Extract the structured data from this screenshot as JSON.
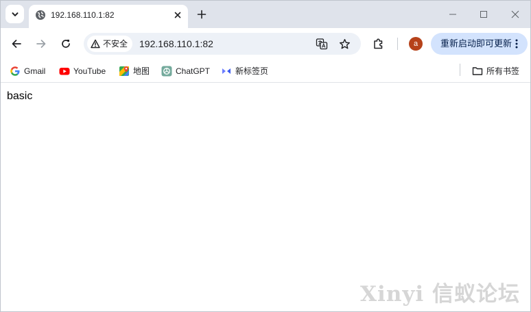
{
  "browser": {
    "tab": {
      "title": "192.168.110.1:82"
    },
    "address_bar": {
      "security_label": "不安全",
      "url": "192.168.110.1:82"
    },
    "profile": {
      "initial": "a",
      "color": "#b6421a"
    },
    "update_button": {
      "label": "重新启动即可更新"
    },
    "bookmarks": [
      {
        "label": "Gmail",
        "icon": "google-icon"
      },
      {
        "label": "YouTube",
        "icon": "youtube-icon"
      },
      {
        "label": "地图",
        "icon": "maps-icon"
      },
      {
        "label": "ChatGPT",
        "icon": "chatgpt-icon"
      },
      {
        "label": "新标签页",
        "icon": "new-tab-page-icon"
      }
    ],
    "all_bookmarks_label": "所有书签",
    "accent_color": "#d3e3fd"
  },
  "page": {
    "text": "basic",
    "watermark": "Xinyi 信蚁论坛"
  }
}
